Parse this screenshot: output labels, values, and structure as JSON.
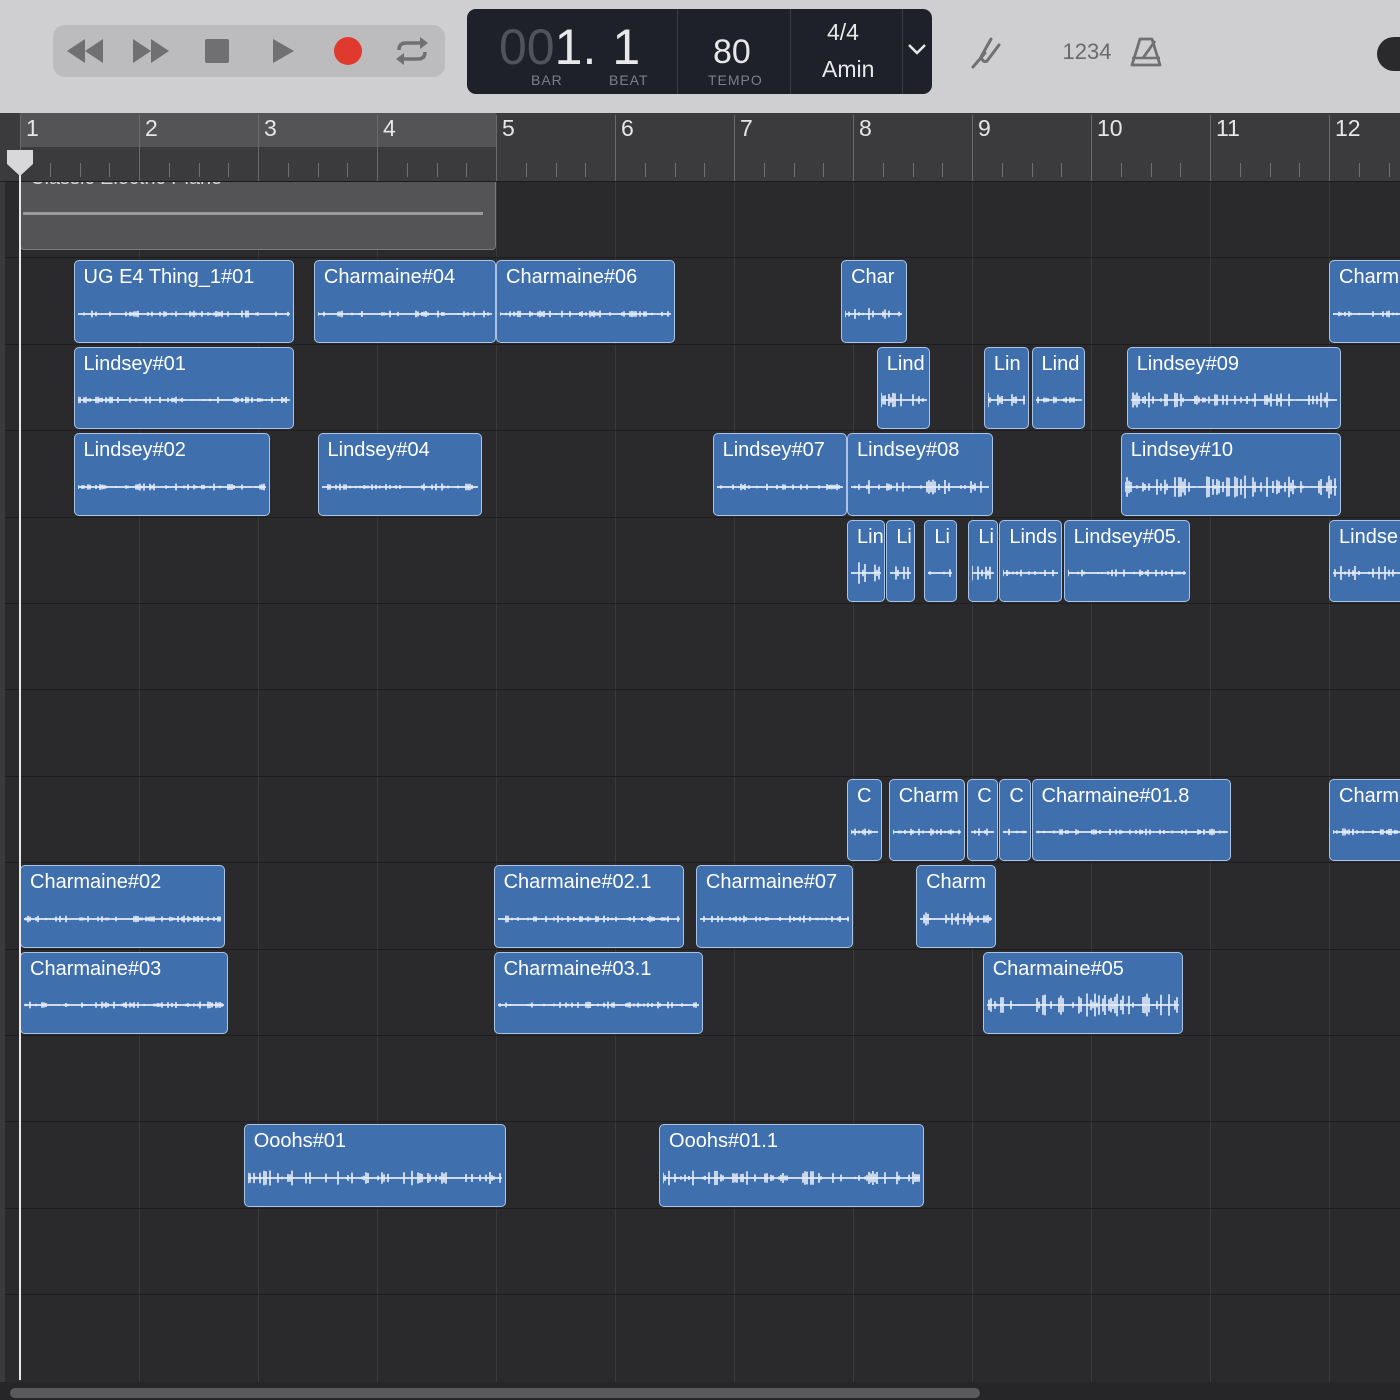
{
  "transport": {
    "buttons": [
      {
        "name": "rewind-button",
        "icon": "rewind-icon"
      },
      {
        "name": "fast-forward-button",
        "icon": "fast-forward-icon"
      },
      {
        "name": "stop-button",
        "icon": "stop-icon"
      },
      {
        "name": "play-button",
        "icon": "play-icon"
      },
      {
        "name": "record-button",
        "icon": "record-icon",
        "color": "#e03a2f"
      },
      {
        "name": "cycle-button",
        "icon": "cycle-icon"
      }
    ]
  },
  "lcd": {
    "bar_dim": "00",
    "bar_value": "1",
    "dot": ".",
    "beat_value": "1",
    "bar_label": "BAR",
    "beat_label": "BEAT",
    "tempo": "80",
    "tempo_label": "TEMPO",
    "time_signature": "4/4",
    "key": "Amin"
  },
  "toolbar_right": {
    "tuner_icon": "tuning-fork-icon",
    "count_in": "1234",
    "metronome_icon": "metronome-icon"
  },
  "ruler": {
    "bars": [
      "1",
      "2",
      "3",
      "4",
      "5",
      "6",
      "7",
      "8",
      "9",
      "10",
      "11",
      "12"
    ]
  },
  "midi_region": {
    "name": "Classic Electric Piano"
  },
  "lanes": [
    {
      "regions": []
    },
    {
      "regions": [
        {
          "name": "UG E4 Thing_1#01",
          "start": 1.45,
          "end": 3.3,
          "amp": "low"
        },
        {
          "name": "Charmaine#04",
          "start": 3.47,
          "end": 5.0,
          "amp": "low"
        },
        {
          "name": "Charmaine#06",
          "start": 5.0,
          "end": 6.5,
          "amp": "low"
        },
        {
          "name": "Char",
          "start": 7.9,
          "end": 8.45,
          "amp": "mid"
        },
        {
          "name": "Charm",
          "start": 12.0,
          "end": 12.7,
          "amp": "low"
        }
      ]
    },
    {
      "regions": [
        {
          "name": "Lindsey#01",
          "start": 1.45,
          "end": 3.3,
          "amp": "low"
        },
        {
          "name": "Lind",
          "start": 8.2,
          "end": 8.65,
          "amp": "mid"
        },
        {
          "name": "Lin",
          "start": 9.1,
          "end": 9.48,
          "amp": "mid"
        },
        {
          "name": "Lind",
          "start": 9.5,
          "end": 9.95,
          "amp": "low"
        },
        {
          "name": "Lindsey#09",
          "start": 10.3,
          "end": 12.1,
          "amp": "mid"
        }
      ]
    },
    {
      "regions": [
        {
          "name": "Lindsey#02",
          "start": 1.45,
          "end": 3.1,
          "amp": "low"
        },
        {
          "name": "Lindsey#04",
          "start": 3.5,
          "end": 4.88,
          "amp": "low"
        },
        {
          "name": "Lindsey#07",
          "start": 6.82,
          "end": 7.95,
          "amp": "low"
        },
        {
          "name": "Lindsey#08",
          "start": 7.95,
          "end": 9.18,
          "amp": "mid"
        },
        {
          "name": "Lindsey#10",
          "start": 10.25,
          "end": 12.1,
          "amp": "high"
        }
      ]
    },
    {
      "regions": [
        {
          "name": "Lin",
          "start": 7.95,
          "end": 8.27,
          "amp": "high"
        },
        {
          "name": "Li",
          "start": 8.28,
          "end": 8.52,
          "amp": "mid"
        },
        {
          "name": "Li",
          "start": 8.6,
          "end": 8.87,
          "amp": "mid"
        },
        {
          "name": "Li",
          "start": 8.97,
          "end": 9.22,
          "amp": "mid"
        },
        {
          "name": "Linds",
          "start": 9.23,
          "end": 9.76,
          "amp": "low"
        },
        {
          "name": "Lindsey#05.",
          "start": 9.77,
          "end": 10.83,
          "amp": "low"
        },
        {
          "name": "Lindse",
          "start": 12.0,
          "end": 12.7,
          "amp": "mid"
        }
      ]
    },
    {
      "regions": []
    },
    {
      "regions": []
    },
    {
      "regions": [
        {
          "name": "C",
          "start": 7.95,
          "end": 8.24,
          "amp": "low"
        },
        {
          "name": "Charm",
          "start": 8.3,
          "end": 8.94,
          "amp": "low"
        },
        {
          "name": "C",
          "start": 8.96,
          "end": 9.22,
          "amp": "low"
        },
        {
          "name": "C",
          "start": 9.23,
          "end": 9.5,
          "amp": "low"
        },
        {
          "name": "Charmaine#01.8",
          "start": 9.5,
          "end": 11.18,
          "amp": "low"
        },
        {
          "name": "Charm",
          "start": 12.0,
          "end": 12.7,
          "amp": "low"
        }
      ]
    },
    {
      "regions": [
        {
          "name": "Charmaine#02",
          "start": 1.0,
          "end": 2.72,
          "amp": "low"
        },
        {
          "name": "Charmaine#02.1",
          "start": 4.98,
          "end": 6.58,
          "amp": "low"
        },
        {
          "name": "Charmaine#07",
          "start": 6.68,
          "end": 8.0,
          "amp": "low"
        },
        {
          "name": "Charm",
          "start": 8.53,
          "end": 9.2,
          "amp": "mid"
        }
      ]
    },
    {
      "regions": [
        {
          "name": "Charmaine#03",
          "start": 1.0,
          "end": 2.75,
          "amp": "low"
        },
        {
          "name": "Charmaine#03.1",
          "start": 4.98,
          "end": 6.74,
          "amp": "low"
        },
        {
          "name": "Charmaine#05",
          "start": 9.09,
          "end": 10.77,
          "amp": "high"
        }
      ]
    },
    {
      "regions": []
    },
    {
      "regions": [
        {
          "name": "Ooohs#01",
          "start": 2.88,
          "end": 5.08,
          "amp": "mid"
        },
        {
          "name": "Ooohs#01.1",
          "start": 6.37,
          "end": 8.6,
          "amp": "mid"
        }
      ]
    },
    {
      "regions": []
    }
  ],
  "colors": {
    "region_fill": "#3f70ad",
    "region_border": "#a9c5e6",
    "background": "#2a2a2c",
    "record": "#e03a2f"
  }
}
